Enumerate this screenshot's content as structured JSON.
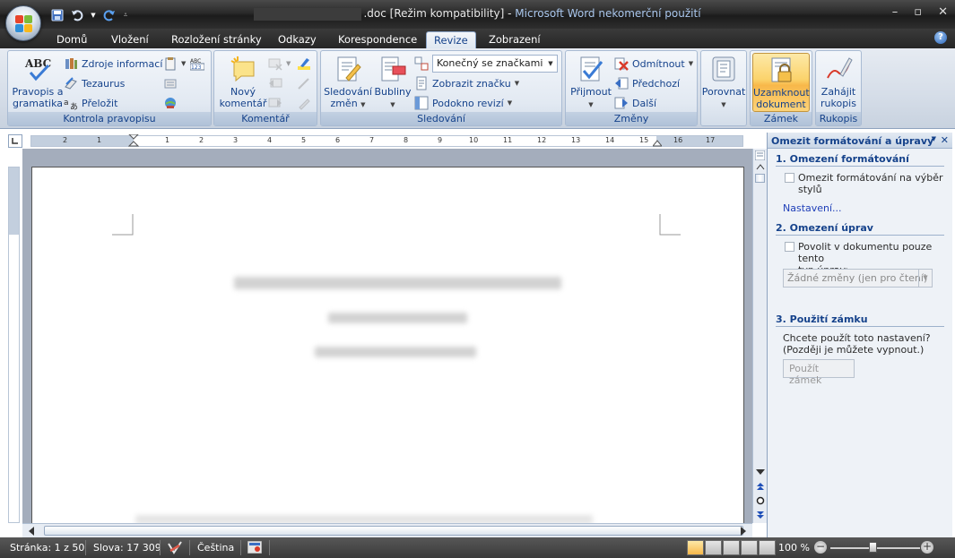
{
  "window": {
    "title_doc": ".doc [Režim kompatibility]",
    "title_sep": " - ",
    "title_app": "Microsoft Word nekomerční použití"
  },
  "tabs": [
    {
      "label": "Domů"
    },
    {
      "label": "Vložení"
    },
    {
      "label": "Rozložení stránky"
    },
    {
      "label": "Odkazy"
    },
    {
      "label": "Korespondence"
    },
    {
      "label": "Revize",
      "active": true
    },
    {
      "label": "Zobrazení"
    }
  ],
  "ribbon": {
    "proofing": {
      "label": "Kontrola pravopisu",
      "spelling_line1": "Pravopis a",
      "spelling_line2": "gramatika",
      "research": "Zdroje informací",
      "thesaurus": "Tezaurus",
      "translate": "Přeložit"
    },
    "comments": {
      "label": "Komentář",
      "new_line1": "Nový",
      "new_line2": "komentář"
    },
    "tracking": {
      "label": "Sledování",
      "track_line1": "Sledování",
      "track_line2": "změn",
      "balloons": "Bubliny",
      "display_combo": "Konečný se značkami",
      "show_markup": "Zobrazit značku",
      "reviewing_pane": "Podokno revizí"
    },
    "changes": {
      "label": "Změny",
      "accept": "Přijmout",
      "reject": "Odmítnout",
      "previous": "Předchozí",
      "next": "Další"
    },
    "compare": {
      "label": "Porovnat"
    },
    "protect": {
      "label": "Zámek",
      "lock_line1": "Uzamknout",
      "lock_line2": "dokument"
    },
    "ink": {
      "label": "Rukopis",
      "start_line1": "Zahájit",
      "start_line2": "rukopis"
    }
  },
  "task_pane": {
    "title": "Omezit formátování a úpravy",
    "section1_title": "1. Omezení formátování",
    "section1_check_line1": "Omezit formátování na výběr",
    "section1_check_line2": "stylů",
    "section1_link": "Nastavení...",
    "section2_title": "2. Omezení úprav",
    "section2_check_line1": "Povolit v dokumentu pouze tento",
    "section2_check_line2": "typ úprav:",
    "section2_combo": "Žádné změny (jen pro čtení)",
    "section3_title": "3. Použití zámku",
    "section3_text_line1": "Chcete použít toto nastavení?",
    "section3_text_line2": "(Později je můžete vypnout.)",
    "section3_button": "Použít zámek"
  },
  "status_bar": {
    "page": "Stránka: 1 z 50",
    "words": "Slova: 17 309",
    "language": "Čeština",
    "zoom": "100 %"
  },
  "ruler": {
    "marks": [
      "2",
      "1",
      "1",
      "2",
      "3",
      "4",
      "5",
      "6",
      "7",
      "8",
      "9",
      "10",
      "11",
      "12",
      "13",
      "14",
      "15",
      "16",
      "17"
    ]
  },
  "colors": {
    "ribbon_text": "#15428b",
    "active_button": "#f8b84a",
    "titlebar": "#2a2a2a"
  }
}
